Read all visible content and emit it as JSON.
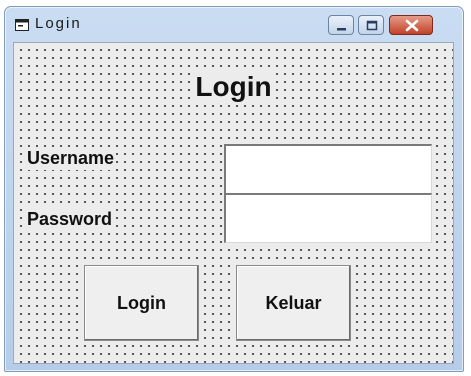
{
  "window": {
    "title": "Login"
  },
  "form": {
    "heading": "Login",
    "username_label": "Username",
    "password_label": "Password",
    "username_value": "",
    "password_value": ""
  },
  "buttons": {
    "login_label": "Login",
    "exit_label": "Keluar"
  },
  "icons": {
    "app": "form-icon",
    "minimize": "minimize-icon",
    "maximize": "maximize-icon",
    "close": "close-icon"
  },
  "colors": {
    "client_background": "#ececec",
    "close_button": "#c2422a",
    "titlebar": "#c9dcf2"
  }
}
